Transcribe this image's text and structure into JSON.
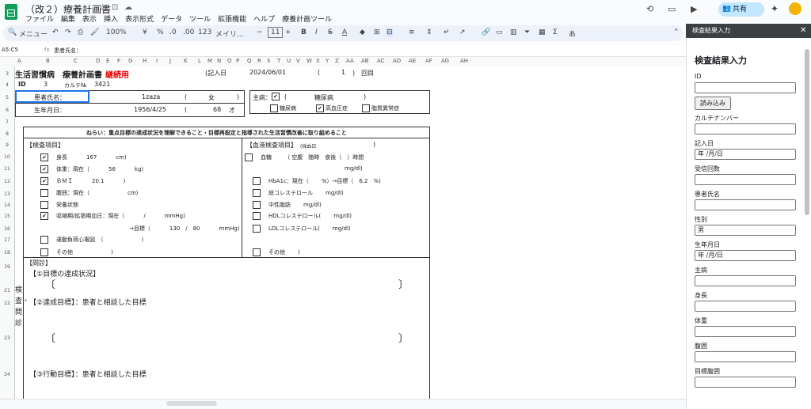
{
  "app": {
    "doc_title": "（改２）療養計画書",
    "menu": [
      "ファイル",
      "編集",
      "表示",
      "挿入",
      "表示形式",
      "データ",
      "ツール",
      "拡張機能",
      "ヘルプ",
      "療養計画ツール"
    ],
    "share_label": "共有"
  },
  "toolbar": {
    "search": "メニュー",
    "zoom": "100%",
    "currency": "¥",
    "percent": "%",
    "dec_minus": ".0",
    "dec_plus": ".00",
    "num_fmt": "123",
    "font": "メイリ...",
    "font_size": "11"
  },
  "formula": {
    "cell_ref": "A5:C5",
    "fx": "fx",
    "content": "患者氏名："
  },
  "columns": [
    "A",
    "B",
    "C",
    "D",
    "E",
    "F",
    "G",
    "H",
    "I",
    "J",
    "K",
    "L",
    "M",
    "N",
    "O",
    "P",
    "Q",
    "R",
    "S",
    "T",
    "U",
    "V",
    "W",
    "X",
    "Y",
    "Z",
    "AA",
    "AB",
    "AC",
    "AD",
    "AE",
    "AF",
    "AG",
    "AH"
  ],
  "rows": [
    "3",
    "4",
    "5",
    "6",
    "7",
    "8",
    "9",
    "10",
    "11",
    "12",
    "13",
    "14",
    "15",
    "16",
    "17",
    "18",
    "19",
    "21",
    "22",
    "23",
    "24"
  ],
  "sheet": {
    "title_left": "生活習慣病　療養計画書",
    "title_tag": "継続用",
    "entry_date_label": "(記入日",
    "entry_date": "2024/06/01",
    "paren_open": "(",
    "count": "1",
    "count_suffix": ")　回目",
    "id_label": "ID",
    "id_value": "3",
    "karte_label": "カルテ№",
    "karte_value": "3421",
    "patient_label": "患者氏名：",
    "patient_name": "1zaza",
    "sex": "女",
    "dob_label": "生年月日：",
    "dob": "1956/4/25",
    "age": "68",
    "age_unit": "才",
    "disease_label": "主病：",
    "disease": "糖尿病",
    "d1": "糖尿病",
    "d2": "高血圧症",
    "d3": "脂質異常症",
    "aim": "ねらい：重点目標の達成状況を理解できること・目標再設定と指導された生活習慣改善に取り組めること",
    "exam_title": "【検査項目】",
    "exam": [
      {
        "label": "身長",
        "value": "167",
        "unit": "cm)"
      },
      {
        "label": "体重：現在（",
        "value": "56",
        "unit": "kg)"
      },
      {
        "label": "ＢＭＩ",
        "value": "20.1",
        "unit": ")"
      },
      {
        "label": "腹囲：現在（",
        "value": "",
        "unit": "cm)"
      },
      {
        "label": "栄養状態",
        "value": "",
        "unit": ""
      },
      {
        "label": "収縮期/拡張期血圧：現在（",
        "value": "/",
        "unit": "mmHg)"
      },
      {
        "label": "→目標（",
        "value": "130　/　80",
        "unit": "mmHg)"
      },
      {
        "label": "運動負荷心電図　（",
        "value": "",
        "unit": ")"
      },
      {
        "label": "その他",
        "value": "",
        "unit": ")"
      }
    ],
    "blood_title": "【血液検査項目】",
    "blood_note": "(採血日",
    "blood": [
      {
        "label": "血糖",
        "extra": "（ 空腹　随時　食後（　）時間"
      },
      {
        "label": "",
        "extra": "mg/dl)"
      },
      {
        "label": "HbA1c：現在（",
        "extra": "%）→目標（　6.2　%)"
      },
      {
        "label": "総コレステロール",
        "extra": "mg/dl)"
      },
      {
        "label": "中性脂肪",
        "extra": "mg/dl)"
      },
      {
        "label": "HDLコレステロール(",
        "extra": "mg/dl)"
      },
      {
        "label": "LDLコレステロール(",
        "extra": "mg/dl)"
      },
      {
        "label": "その他",
        "extra": ")"
      }
    ],
    "interview_title": "【問診】",
    "vert_label": "検査・問診",
    "q1": "【①目標の達成状況】",
    "q2": "【②達成目標】：患者と相談した目標",
    "q3": "【③行動目標】：患者と相談した目標"
  },
  "panel": {
    "header": "検査結果入力",
    "title": "検査結果入力",
    "load_button": "読み込み",
    "fields": [
      {
        "label": "ID",
        "value": ""
      },
      {
        "label": "カルテナンバー",
        "value": ""
      },
      {
        "label": "記入日",
        "value": "年 /月/日"
      },
      {
        "label": "受信回数",
        "value": ""
      },
      {
        "label": "患者氏名",
        "value": ""
      },
      {
        "label": "性別",
        "value": "男"
      },
      {
        "label": "生年月日",
        "value": "年 /月/日"
      },
      {
        "label": "主病",
        "value": ""
      },
      {
        "label": "身長",
        "value": ""
      },
      {
        "label": "体重",
        "value": ""
      },
      {
        "label": "腹囲",
        "value": ""
      },
      {
        "label": "目標腹囲",
        "value": ""
      }
    ]
  }
}
